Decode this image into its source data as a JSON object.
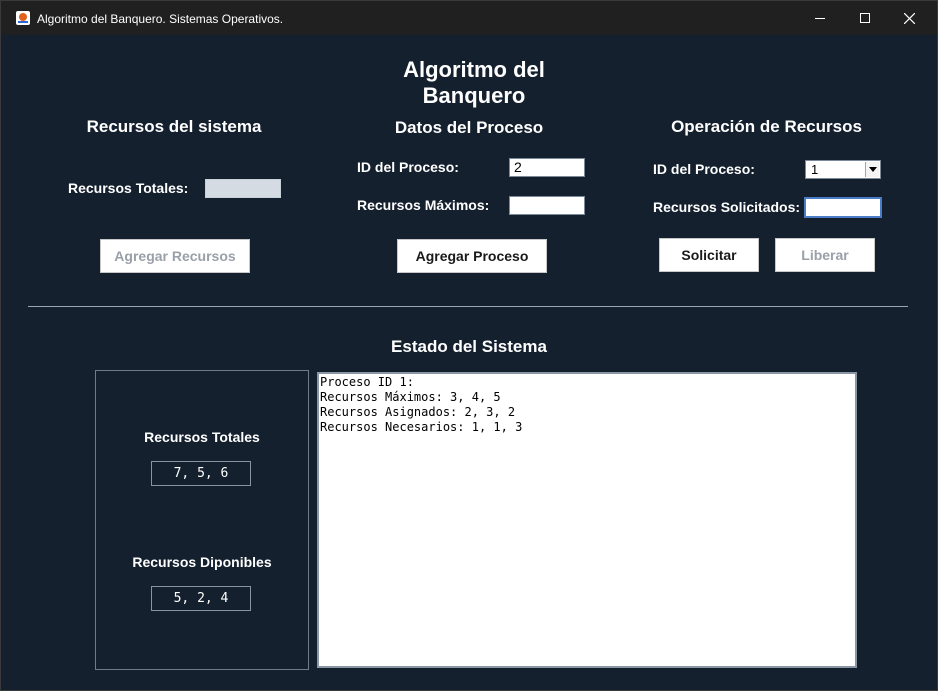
{
  "window": {
    "title": "Algoritmo del Banquero. Sistemas Operativos."
  },
  "header": {
    "title": "Algoritmo del Banquero"
  },
  "system_resources": {
    "title": "Recursos del sistema",
    "total_label": "Recursos Totales:",
    "total_value": "",
    "add_button": "Agregar Recursos"
  },
  "process_data": {
    "title": "Datos del Proceso",
    "id_label": "ID del Proceso:",
    "id_value": "2",
    "max_label": "Recursos Máximos:",
    "max_value": "",
    "add_button": "Agregar Proceso"
  },
  "operation": {
    "title": "Operación de Recursos",
    "id_label": "ID del Proceso:",
    "id_selected": "1",
    "requested_label": "Recursos Solicitados:",
    "requested_value": "",
    "request_button": "Solicitar",
    "release_button": "Liberar"
  },
  "state": {
    "title": "Estado del Sistema",
    "total_label": "Recursos Totales",
    "total_value": "7, 5, 6",
    "available_label": "Recursos Diponibles",
    "available_value": "5, 2, 4",
    "log_lines": [
      "Proceso ID 1:",
      "Recursos Máximos: 3, 4, 5",
      "Recursos Asignados: 2, 3, 2",
      "Recursos Necesarios: 1, 1, 3"
    ]
  }
}
